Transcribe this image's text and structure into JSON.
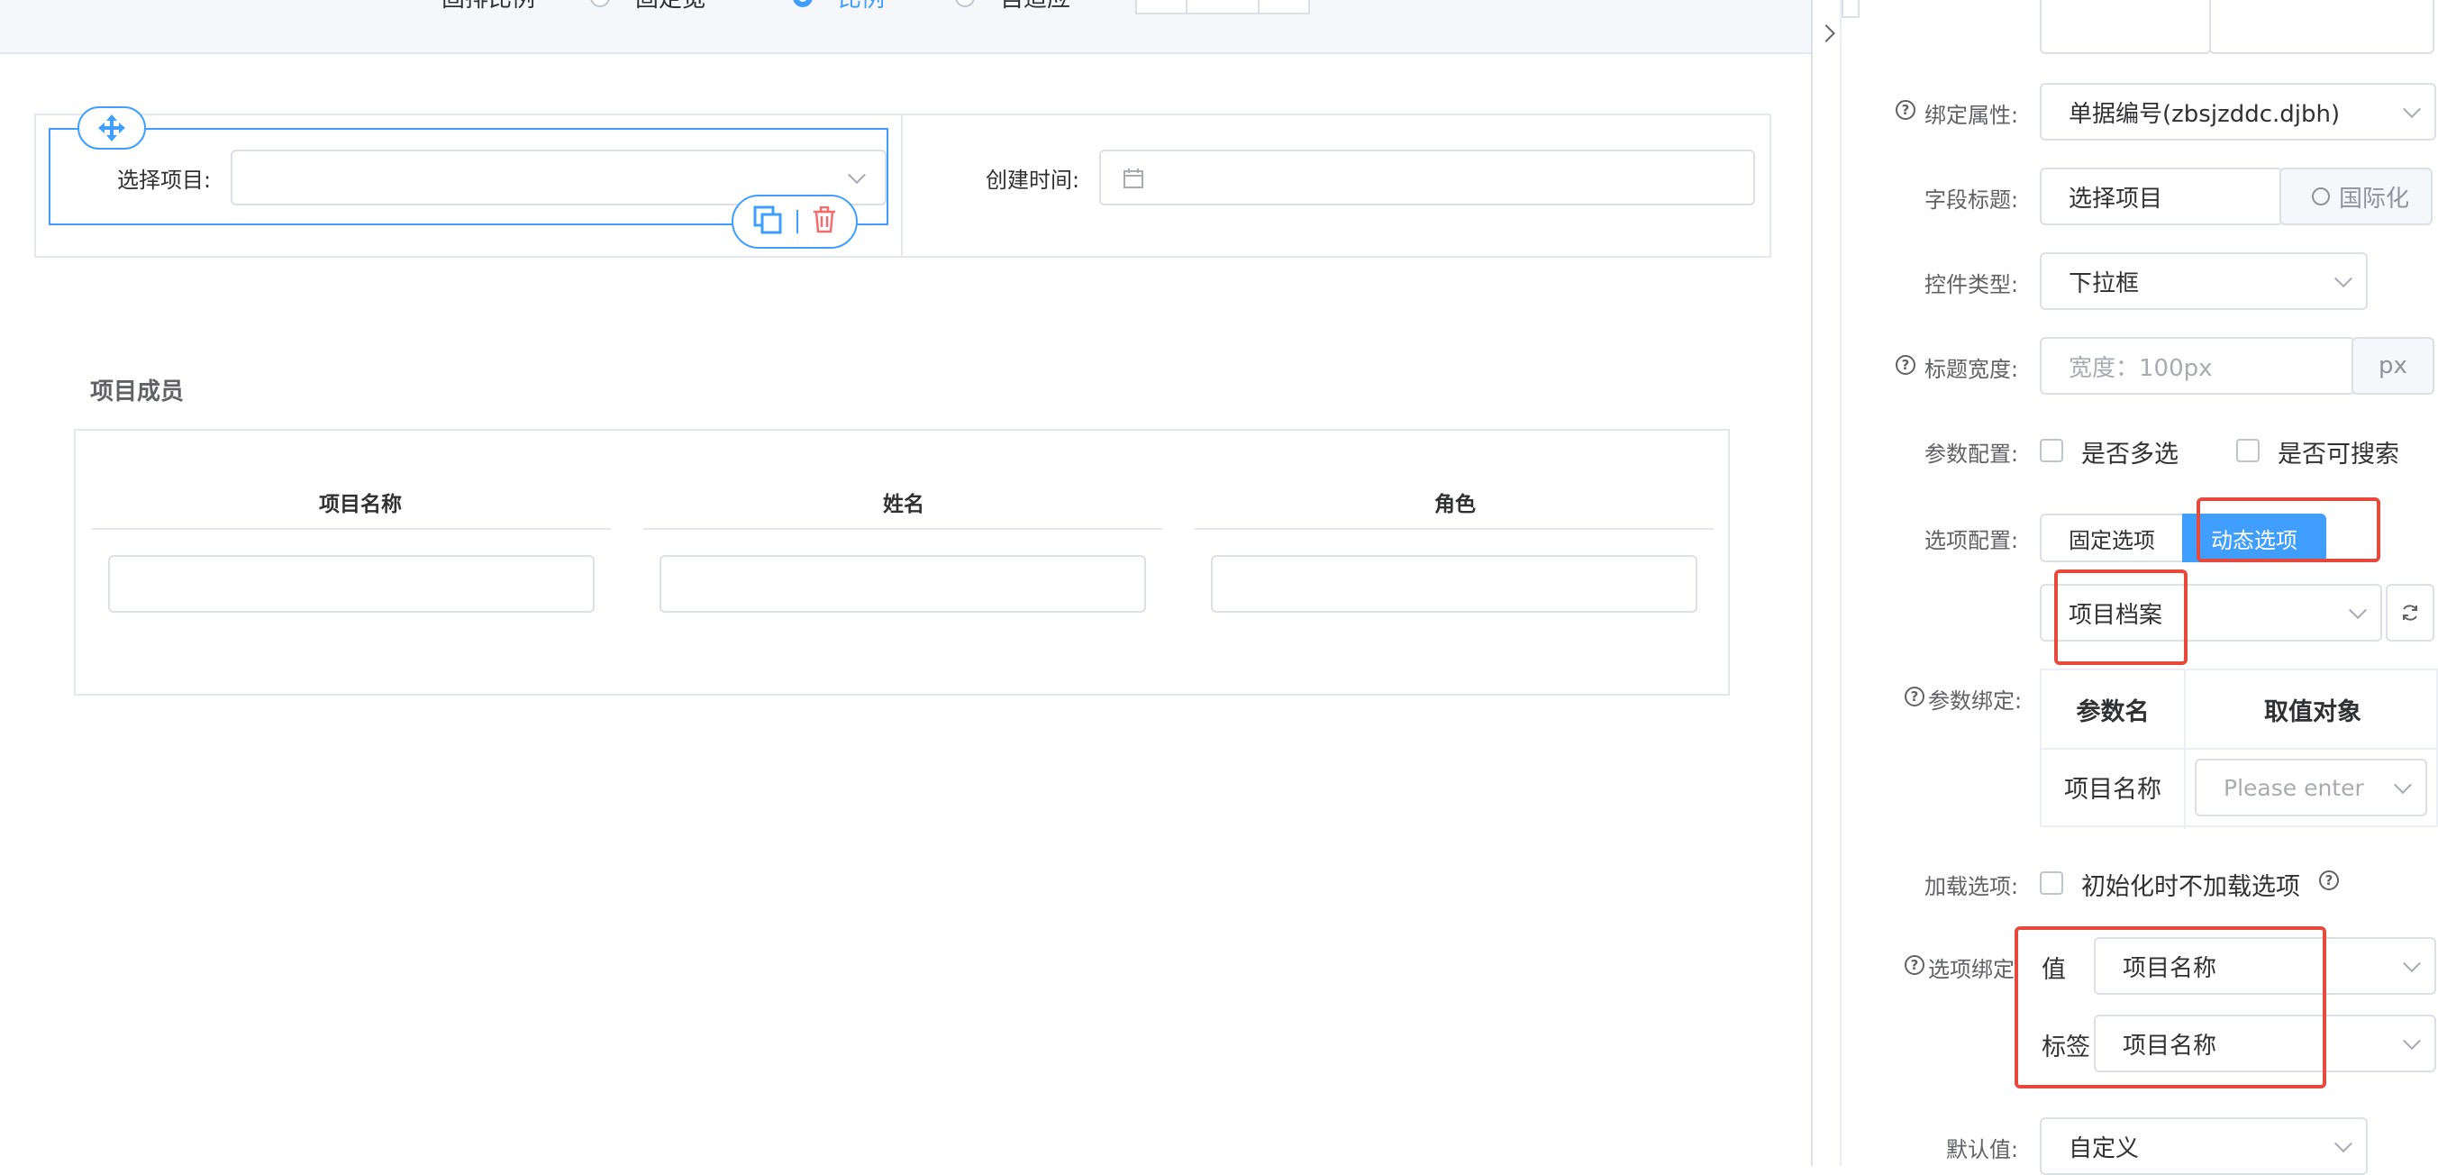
{
  "canvas": {
    "topbar": {
      "label": "固排比例",
      "radios": [
        {
          "label": "固定宽",
          "checked": false
        },
        {
          "label": "比例",
          "checked": true
        },
        {
          "label": "自适应",
          "checked": false
        }
      ]
    },
    "form": {
      "select_project_label": "选择项目:",
      "created_time_label": "创建时间:"
    },
    "subtable": {
      "title": "项目成员",
      "columns": [
        "项目名称",
        "姓名",
        "角色"
      ]
    }
  },
  "panel": {
    "bind_attr": {
      "label": "绑定属性:",
      "value": "单据编号(zbsjzddc.djbh)"
    },
    "field_title": {
      "label": "字段标题:",
      "value": "选择项目",
      "i18n": "国际化"
    },
    "control_type": {
      "label": "控件类型:",
      "value": "下拉框"
    },
    "title_width": {
      "label": "标题宽度:",
      "placeholder": "宽度：100px",
      "unit": "px"
    },
    "param_config": {
      "label": "参数配置:",
      "multi": "是否多选",
      "searchable": "是否可搜索"
    },
    "option_config": {
      "label": "选项配置:",
      "fixed": "固定选项",
      "dynamic": "动态选项",
      "source": "项目档案"
    },
    "param_bind": {
      "label": "参数绑定:",
      "headers": [
        "参数名",
        "取值对象"
      ],
      "rows": [
        {
          "name": "项目名称",
          "placeholder": "Please enter"
        }
      ]
    },
    "load_options": {
      "label": "加载选项:",
      "text": "初始化时不加载选项"
    },
    "option_bind": {
      "label": "选项绑定",
      "value_label": "值",
      "value": "项目名称",
      "tag_label": "标签",
      "tag": "项目名称"
    },
    "default_value": {
      "label": "默认值:",
      "value": "自定义"
    }
  },
  "colors": {
    "primary": "#409eff",
    "danger": "#f56c6c",
    "annotation": "#e64a3c"
  }
}
